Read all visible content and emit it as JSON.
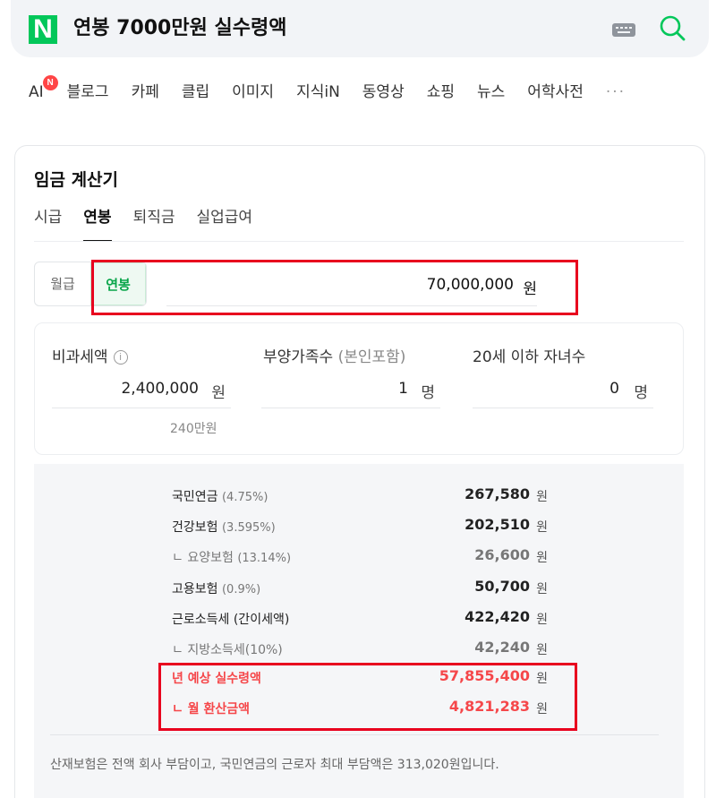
{
  "search": {
    "query": "연봉 7000만원 실수령액"
  },
  "nav": {
    "ai_label": "AI",
    "ai_badge": "N",
    "items": [
      "블로그",
      "카페",
      "클립",
      "이미지",
      "지식iN",
      "동영상",
      "쇼핑",
      "뉴스",
      "어학사전"
    ],
    "more": "···"
  },
  "calculator": {
    "title": "임금 계산기",
    "tabs": [
      "시급",
      "연봉",
      "퇴직금",
      "실업급여"
    ],
    "active_tab": "연봉",
    "toggle": [
      "월급",
      "연봉"
    ],
    "amount": "70,000,000",
    "amount_unit": "원",
    "options": {
      "nontax_label": "비과세액",
      "nontax_value": "2,400,000",
      "nontax_unit": "원",
      "nontax_hint": "240만원",
      "dependents_label": "부양가족수",
      "dependents_sub": "(본인포함)",
      "dependents_value": "1",
      "dependents_unit": "명",
      "children_label": "20세 이하 자녀수",
      "children_value": "0",
      "children_unit": "명"
    },
    "results": [
      {
        "label": "국민연금",
        "pct": "(4.75%)",
        "value": "267,580",
        "unit": "원"
      },
      {
        "label": "건강보험",
        "pct": "(3.595%)",
        "value": "202,510",
        "unit": "원"
      },
      {
        "label": "ㄴ 요양보험",
        "pct": "(13.14%)",
        "value": "26,600",
        "unit": "원"
      },
      {
        "label": "고용보험",
        "pct": "(0.9%)",
        "value": "50,700",
        "unit": "원"
      },
      {
        "label": "근로소득세 (간이세액)",
        "pct": "",
        "value": "422,420",
        "unit": "원"
      },
      {
        "label": "ㄴ 지방소득세(10%)",
        "pct": "",
        "value": "42,240",
        "unit": "원"
      },
      {
        "label": "년 예상 실수령액",
        "pct": "",
        "value": "57,855,400",
        "unit": "원"
      },
      {
        "label": "ㄴ 월 환산금액",
        "pct": "",
        "value": "4,821,283",
        "unit": "원"
      }
    ],
    "note": "산재보험은 전액 회사 부담이고, 국민연금의 근로자 최대 부담액은 313,020원입니다."
  },
  "colors": {
    "brand": "#03c75a",
    "accent_red": "#f5474a",
    "highlight": "#e8001e"
  }
}
